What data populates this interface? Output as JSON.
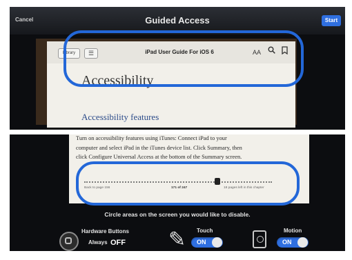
{
  "colors": {
    "accent": "#2f6fe0",
    "annotation": "#2367d8"
  },
  "navbar": {
    "title": "Guided Access",
    "cancel_label": "Cancel",
    "start_label": "Start"
  },
  "book_toolbar": {
    "library_label": "Library",
    "title": "iPad User Guide For iOS 6",
    "font_icon": "AA",
    "search_icon": "search-icon",
    "bookmark_icon": "bookmark-icon"
  },
  "book": {
    "heading": "Accessibility",
    "subheading": "Accessibility features",
    "lines": [
      "Turn on accessibility features using iTunes: Connect iPad to your",
      "computer and select iPad in the iTunes device list. Click Summary, then",
      "click Configure Universal Access at the bottom of the Summary screen."
    ]
  },
  "scrubber": {
    "back_label": "Back to page 156",
    "page_label": "171 of 247",
    "left_label": "18 pages left in this chapter",
    "position": 0.7
  },
  "instruction": "Circle areas on the screen you would like to disable.",
  "options": {
    "hardware": {
      "label": "Hardware Buttons",
      "status_prefix": "Always",
      "status": "OFF"
    },
    "touch": {
      "label": "Touch",
      "toggle": "ON"
    },
    "motion": {
      "label": "Motion",
      "toggle": "ON"
    }
  }
}
